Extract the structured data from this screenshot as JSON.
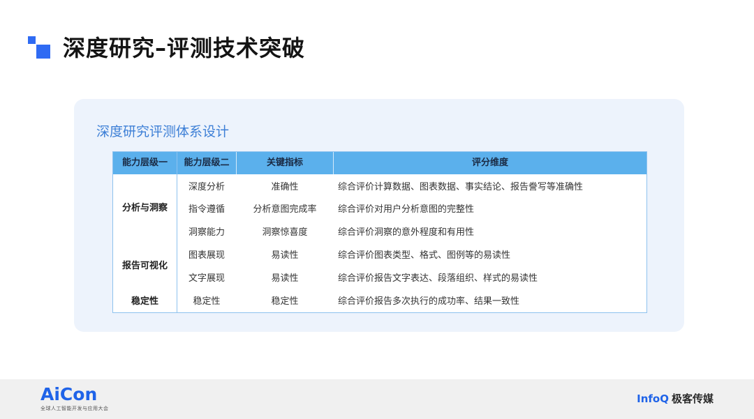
{
  "page": {
    "title": "深度研究–评测技术突破"
  },
  "card": {
    "title": "深度研究评测体系设计"
  },
  "table": {
    "headers": [
      "能力层级一",
      "能力层级二",
      "关键指标",
      "评分维度"
    ],
    "groups": [
      "分析与洞察",
      "报告可视化",
      "稳定性"
    ],
    "rows": [
      {
        "level2": "深度分析",
        "metric": "准确性",
        "dimension": "综合评价计算数据、图表数据、事实结论、报告誊写等准确性"
      },
      {
        "level2": "指令遵循",
        "metric": "分析意图完成率",
        "dimension": "综合评价对用户分析意图的完整性"
      },
      {
        "level2": "洞察能力",
        "metric": "洞察惊喜度",
        "dimension": "综合评价洞察的意外程度和有用性"
      },
      {
        "level2": "图表展现",
        "metric": "易读性",
        "dimension": "综合评价图表类型、格式、图例等的易读性"
      },
      {
        "level2": "文字展现",
        "metric": "易读性",
        "dimension": "综合评价报告文字表达、段落组织、样式的易读性"
      },
      {
        "level2": "稳定性",
        "metric": "稳定性",
        "dimension": "综合评价报告多次执行的成功率、结果一致性"
      }
    ]
  },
  "footer": {
    "left_logo": "AiCon",
    "left_logo_sub": "全球人工智能开发与应用大会",
    "right_logo_brand": "InfoQ",
    "right_logo_name": "极客传媒"
  },
  "colors": {
    "accent": "#2f6bf3",
    "card_bg": "#edf3fc",
    "card_title": "#3d7fd6",
    "table_header": "#5bb0ec",
    "table_border": "#8ec2ee"
  }
}
